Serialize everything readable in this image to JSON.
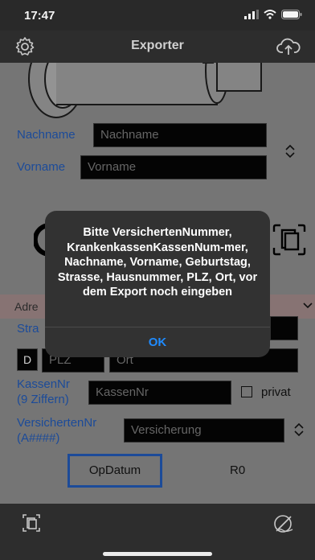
{
  "status": {
    "time": "17:47"
  },
  "nav": {
    "title": "Exporter"
  },
  "form": {
    "nachname_label": "Nachname",
    "nachname_placeholder": "Nachname",
    "vorname_label": "Vorname",
    "vorname_placeholder": "Vorname",
    "section_label": "Adre",
    "strasse_label": "Stra",
    "d_button": "D",
    "plz_placeholder": "PLZ",
    "ort_placeholder": "Ort",
    "kassennr_label_1": "KassenNr",
    "kassennr_label_2": "(9 Ziffern)",
    "kassennr_placeholder": "KassenNr",
    "privat_label": "privat",
    "versichertennr_label_1": "VersichertenNr",
    "versichertennr_label_2": "(A####)",
    "versicherung_placeholder": "Versicherung"
  },
  "bottom": {
    "opdatum": "OpDatum",
    "r0": "R0"
  },
  "alert": {
    "message": "Bitte VersichertenNummer, KrankenkassenKassenNum-mer, Nachname, Vorname, Geburtstag, Strasse, Hausnummer, PLZ, Ort,  vor dem Export noch eingeben",
    "ok": "OK"
  },
  "colors": {
    "accent": "#1e4fa0",
    "alert_button": "#1f8bff"
  }
}
